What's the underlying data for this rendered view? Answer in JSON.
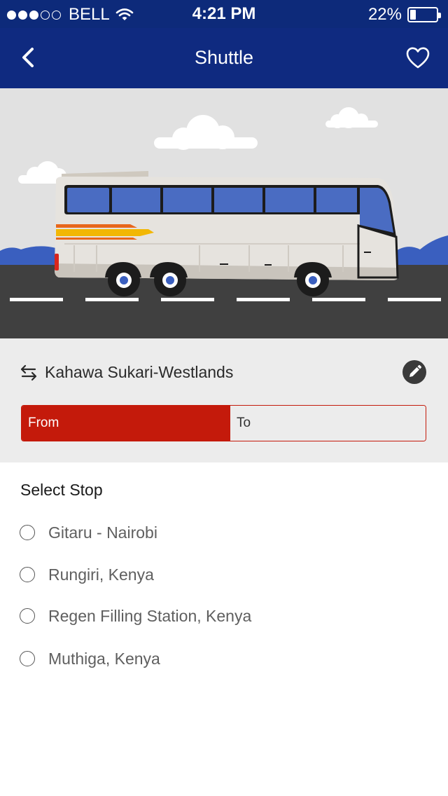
{
  "status_bar": {
    "carrier": "BELL",
    "time": "4:21 PM",
    "battery_text": "22%",
    "battery_level": 0.22,
    "signal_strength": 3,
    "signal_max": 5,
    "icons": [
      "signal-dots-icon",
      "wifi-icon",
      "battery-icon"
    ]
  },
  "header": {
    "title": "Shuttle",
    "icons": [
      "back-chevron-icon",
      "heart-icon"
    ]
  },
  "route": {
    "name": "Kahawa Sukari-Westlands",
    "icons": [
      "swap-arrows-icon",
      "pencil-icon"
    ],
    "tabs": [
      {
        "label": "From",
        "selected": true
      },
      {
        "label": "To",
        "selected": false
      }
    ]
  },
  "stops": {
    "heading": "Select Stop",
    "items": [
      {
        "label": "Gitaru - Nairobi",
        "selected": false
      },
      {
        "label": "Rungiri, Kenya",
        "selected": false
      },
      {
        "label": "Regen Filling Station, Kenya",
        "selected": false
      },
      {
        "label": "Muthiga, Kenya",
        "selected": false
      }
    ]
  },
  "colors": {
    "header_blue": "#0f2a80",
    "accent_red": "#c41a0b",
    "bus_window_blue": "#4a6cc2",
    "stripe_yellow": "#f2b705",
    "stripe_orange": "#e8661b",
    "road": "#404040"
  }
}
